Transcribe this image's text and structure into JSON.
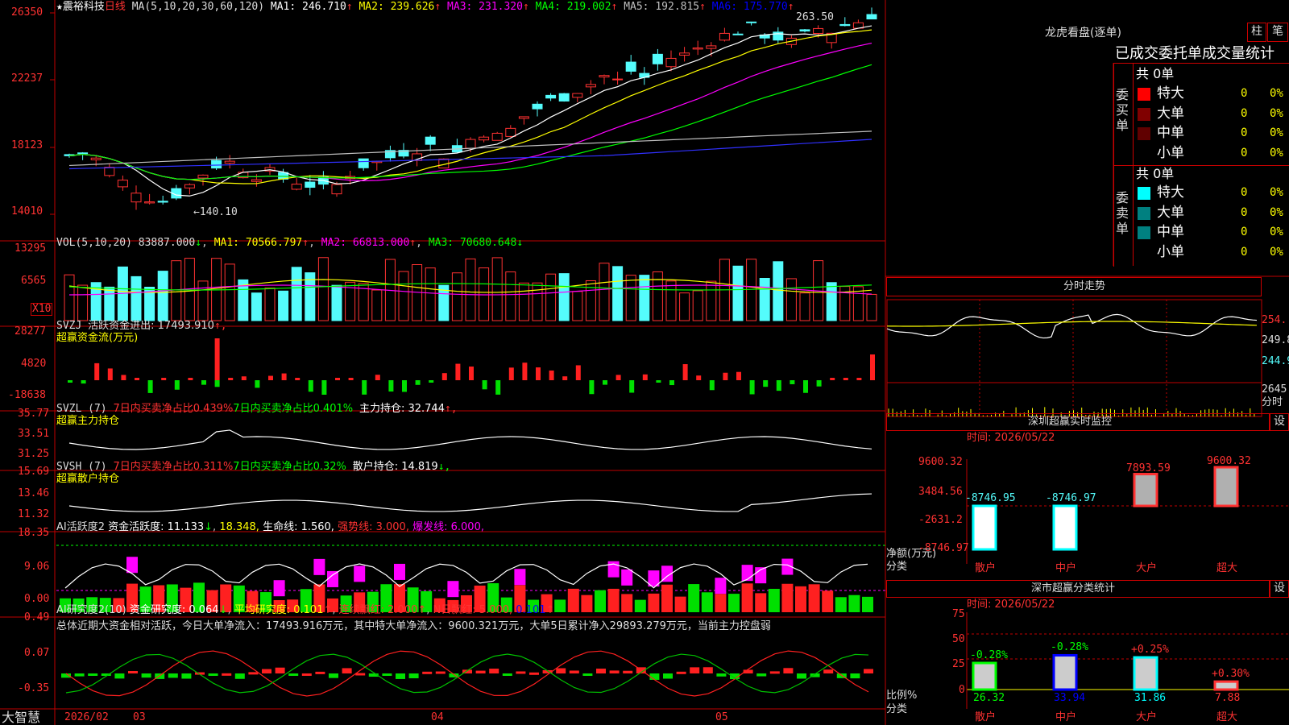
{
  "stock": {
    "name": "震裕科技",
    "period": "日线",
    "ma_label": "MA(5,10,20,30,60,120)",
    "star": "★"
  },
  "colors": {
    "up": "#ff3232",
    "down": "#54fcfc",
    "green": "#00ff00",
    "yellow": "#ffff00",
    "magenta": "#ff00ff",
    "white": "#ffffff",
    "blue": "#0000ff",
    "grid": "#a00000"
  },
  "main_legend": [
    {
      "text": "MA1: 246.710",
      "arrow": "↑",
      "color": "#ffffff"
    },
    {
      "text": "MA2: 239.626",
      "arrow": "↑",
      "color": "#ffff00"
    },
    {
      "text": "MA3: 231.320",
      "arrow": "↑",
      "color": "#ff00ff"
    },
    {
      "text": "MA4: 219.002",
      "arrow": "↑",
      "color": "#00ff00"
    },
    {
      "text": "MA5: 192.815",
      "arrow": "↑",
      "color": "#c0c0c0"
    },
    {
      "text": "MA6: 175.770",
      "arrow": "↑",
      "color": "#0000ff"
    }
  ],
  "price_axis": [
    "26350",
    "22237",
    "18123",
    "14010"
  ],
  "high_label": "263.50",
  "low_label": "←140.10",
  "vol_legend": {
    "label": "VOL(5,10,20)",
    "value": "83887.000",
    "ma1": "MA1: 70566.797",
    "ma2": "MA2: 66813.000",
    "ma3": "MA3: 70680.648"
  },
  "vol_axis": [
    "13295",
    "6565"
  ],
  "vol_unit": "X10",
  "svzj": {
    "label": "SVZJ",
    "text": "活跃资金进出: 17493.910",
    "arrow": "↑,",
    "sub": "超赢资金流(万元)",
    "axis": [
      "28277",
      "4820",
      "-18638"
    ]
  },
  "svzl": {
    "label": "SVZL (7)",
    "t1": "7日内买卖净占比0.439%",
    "t2": "7日内买卖净占比0.401%",
    "t3": "主力持仓: 32.744",
    "arrow": "↑,",
    "sub": "超赢主力持仓",
    "axis": [
      "35.77",
      "33.51",
      "31.25"
    ]
  },
  "svsh": {
    "label": "SVSH (7)",
    "t1": "7日内买卖净占比0.311%",
    "t2": "7日内买卖净占比0.32%",
    "t3": "散户持仓: 14.819",
    "arrow": "↓,",
    "sub": "超赢散户持仓",
    "axis": [
      "15.69",
      "13.46",
      "11.32"
    ]
  },
  "ai_active": {
    "label": "AI活跃度2",
    "t1": "资金活跃度: 11.133",
    "t2": "18.348,",
    "t3": "生命线: 1.560,",
    "t4": "强势线: 3.000,",
    "t5": "爆发线: 6.000,",
    "axis": [
      "18.35",
      "9.06",
      "0.00"
    ]
  },
  "ai_research": {
    "label": "AI研究度2(10)",
    "t1": "资金研究度: 0.064",
    "t2": "平均研究度: 0.101",
    "t3": "连续飘红: 2.000",
    "t4": "N日飘红: 5.000,",
    "t5": "0.101",
    "summary": "总体近期大资金相对活跃，今日大单净流入：17493.916万元，其中特大单净流入：9600.321万元，大单5日累计净入29893.279万元，当前主力控盘弱",
    "axis": [
      "0.49",
      "0.07",
      "-0.35"
    ]
  },
  "date_axis": {
    "brand": "大智慧",
    "labels": [
      "2026/02",
      "03",
      "04",
      "05"
    ]
  },
  "lhb": {
    "title": "龙虎看盘(逐单)",
    "btn1": "柱",
    "btn2": "笔",
    "header": "已成交委托单成交量统计",
    "buy_label": "委买单",
    "sell_label": "委卖单",
    "buy_total": "共 0单",
    "sell_total": "共 0单",
    "buy_rows": [
      {
        "name": "特大",
        "val": "0",
        "pct": "0%",
        "color": "#ff0000"
      },
      {
        "name": "大单",
        "val": "0",
        "pct": "0%",
        "color": "#800000"
      },
      {
        "name": "中单",
        "val": "0",
        "pct": "0%",
        "color": "#600000"
      },
      {
        "name": "小单",
        "val": "0",
        "pct": "0%",
        "color": ""
      }
    ],
    "sell_rows": [
      {
        "name": "特大",
        "val": "0",
        "pct": "0%",
        "color": "#00ffff"
      },
      {
        "name": "大单",
        "val": "0",
        "pct": "0%",
        "color": "#008080"
      },
      {
        "name": "中单",
        "val": "0",
        "pct": "0%",
        "color": "#008080"
      },
      {
        "name": "小单",
        "val": "0",
        "pct": "0%",
        "color": ""
      }
    ]
  },
  "intraday": {
    "title": "分时走势",
    "axis": [
      "254.",
      "249.8",
      "244.9",
      "2645"
    ],
    "unit": "分时"
  },
  "sz_monitor": {
    "title": "深圳超赢实时监控",
    "btn": "设",
    "time": "时间: 2026/05/22",
    "axis": [
      "9600.32",
      "3484.56",
      "-2631.2",
      "-8746.97"
    ],
    "unit": "净额(万元)",
    "unit2": "分类",
    "categories": [
      "散户",
      "中户",
      "大户",
      "超大"
    ],
    "values": [
      -8746.95,
      -8746.97,
      7893.59,
      9600.32
    ],
    "labels": [
      "-8746.95",
      "-8746.97",
      "7893.59",
      "9600.32"
    ]
  },
  "sz_class": {
    "title": "深市超赢分类统计",
    "btn": "设",
    "time": "时间: 2026/05/22",
    "axis": [
      "75",
      "50",
      "25",
      "0"
    ],
    "unit": "比例%",
    "unit2": "分类",
    "categories": [
      "散户",
      "中户",
      "大户",
      "超大"
    ],
    "changes": [
      "-0.28%",
      "-0.28%",
      "+0.25%",
      "+0.30%"
    ],
    "values": [
      26.32,
      33.94,
      31.86,
      7.88
    ],
    "labels": [
      "26.32",
      "33.94",
      "31.86",
      "7.88"
    ]
  }
}
